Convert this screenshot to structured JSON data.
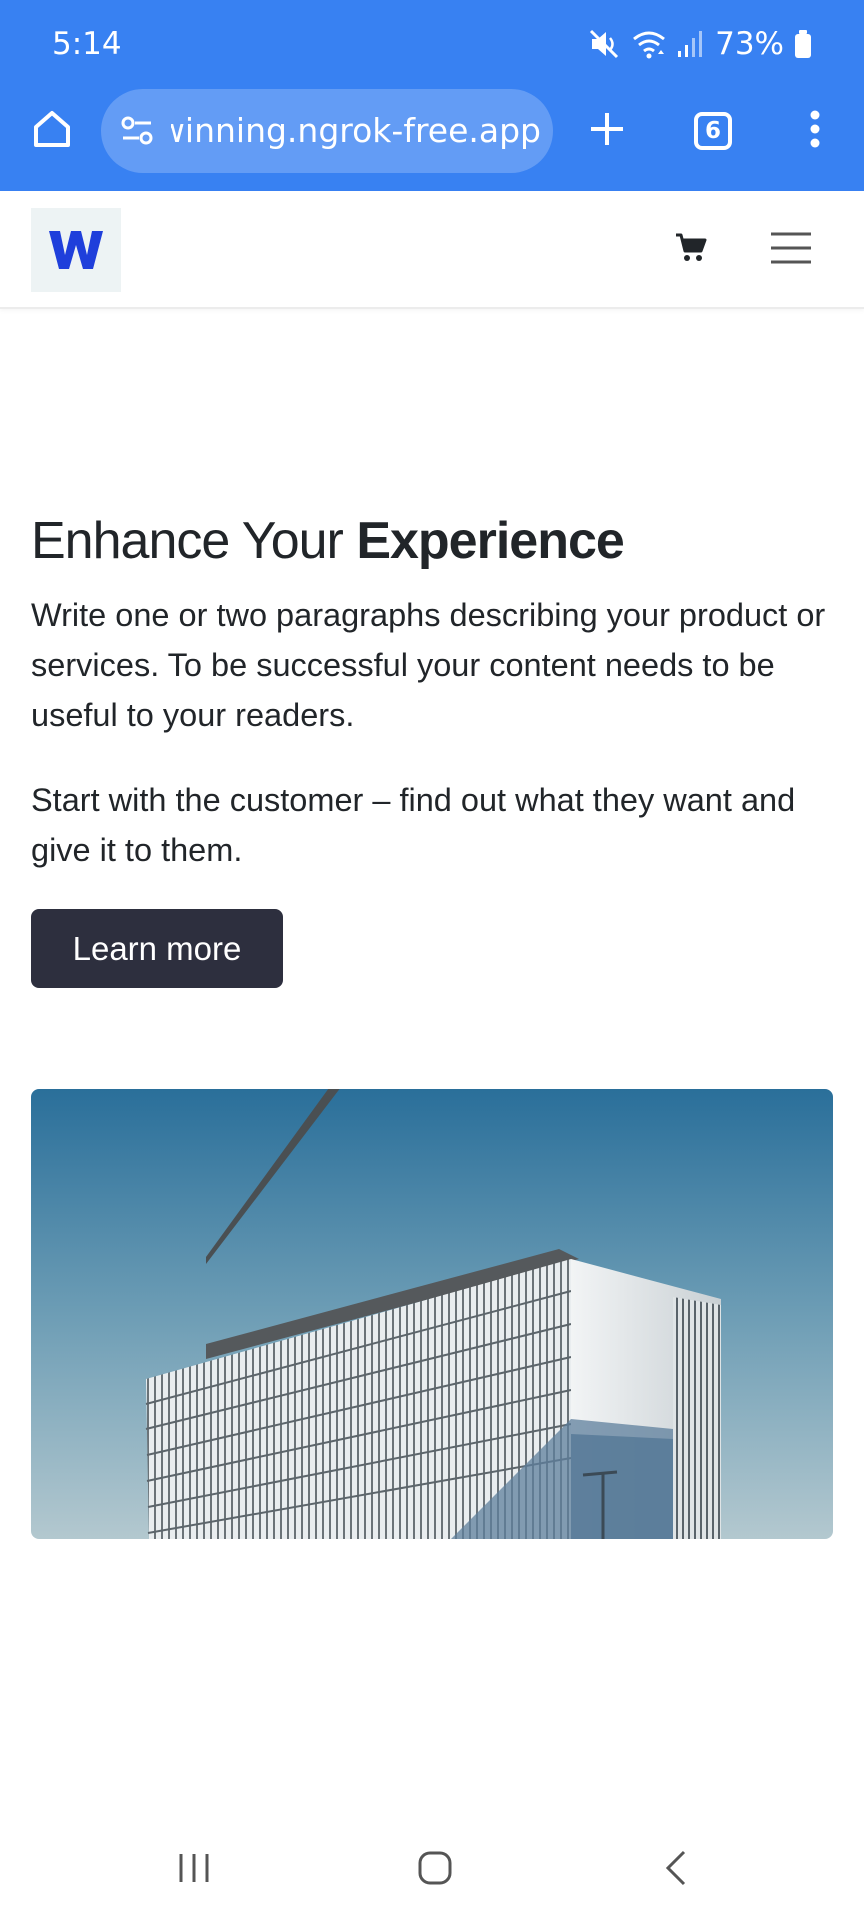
{
  "status_bar": {
    "time": "5:14",
    "battery": "73%",
    "icons": [
      "mute-icon",
      "wifi-icon",
      "signal-icon",
      "battery-icon"
    ]
  },
  "browser": {
    "url": "winning.ngrok-free.app",
    "tab_count": "6",
    "icons": [
      "home-icon",
      "site-settings-icon",
      "new-tab-icon",
      "tabs-icon",
      "more-menu-icon"
    ],
    "toolbar_color": "#3881f2"
  },
  "site": {
    "logo_letter": "W",
    "logo_color": "#1f3fdb",
    "icons": [
      "cart-icon",
      "hamburger-icon"
    ]
  },
  "content": {
    "title_regular": "Enhance Your ",
    "title_bold": "Experience",
    "paragraph_1": "Write one or two paragraphs describing your product or services. To be successful your content needs to be useful to your readers.",
    "paragraph_2": "Start with the customer – find out what they want and give it to them.",
    "cta_label": "Learn more",
    "cta_color": "#2d2f3e",
    "image_subject": "modern-office-building"
  },
  "nav_bar": {
    "icons": [
      "recent-apps-icon",
      "home-circle-icon",
      "back-icon"
    ]
  }
}
